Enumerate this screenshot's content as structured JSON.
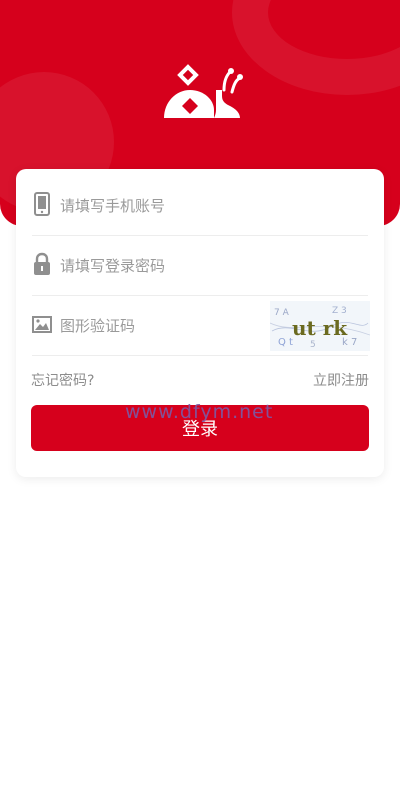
{
  "header": {
    "logo_icon": "snail-logo-icon",
    "background_color": "#d6001c"
  },
  "form": {
    "phone": {
      "icon": "phone-icon",
      "placeholder": "请填写手机账号",
      "value": ""
    },
    "password": {
      "icon": "lock-icon",
      "placeholder": "请填写登录密码",
      "value": ""
    },
    "captcha": {
      "icon": "image-icon",
      "placeholder": "图形验证码",
      "value": "",
      "image_text": "ut rk"
    }
  },
  "links": {
    "forgot": "忘记密码?",
    "register": "立即注册"
  },
  "login_button": "登录",
  "watermark": "www.dfym.net"
}
